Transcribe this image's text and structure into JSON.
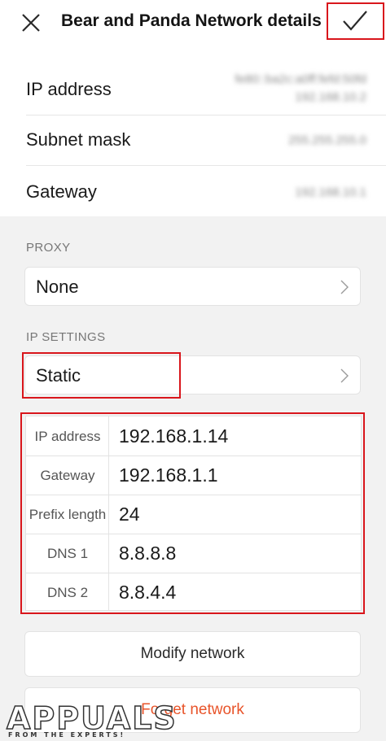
{
  "header": {
    "title": "Bear and Panda Network details",
    "close_icon": "close-icon",
    "confirm_icon": "checkmark-icon"
  },
  "info": {
    "ip_address": {
      "label": "IP address",
      "value_line1": "fe80::ba2c:a0ff:fefd:50fd",
      "value_line2": "192.168.10.2"
    },
    "subnet_mask": {
      "label": "Subnet mask",
      "value": "255.255.255.0"
    },
    "gateway": {
      "label": "Gateway",
      "value": "192.168.10.1"
    }
  },
  "proxy": {
    "section_label": "PROXY",
    "value": "None"
  },
  "ip_settings": {
    "section_label": "IP SETTINGS",
    "value": "Static"
  },
  "static_fields": [
    {
      "label": "IP address",
      "value": "192.168.1.14"
    },
    {
      "label": "Gateway",
      "value": "192.168.1.1"
    },
    {
      "label": "Prefix length",
      "value": "24"
    },
    {
      "label": "DNS 1",
      "value": "8.8.8.8"
    },
    {
      "label": "DNS 2",
      "value": "8.8.4.4"
    }
  ],
  "actions": {
    "modify": "Modify network",
    "forget": "Forget network"
  },
  "watermark": {
    "main": "APPUALS",
    "sub": "FROM THE EXPERTS!"
  },
  "colors": {
    "highlight": "#d9161c",
    "forget_text": "#e8542a",
    "background": "#f2f2f2"
  }
}
